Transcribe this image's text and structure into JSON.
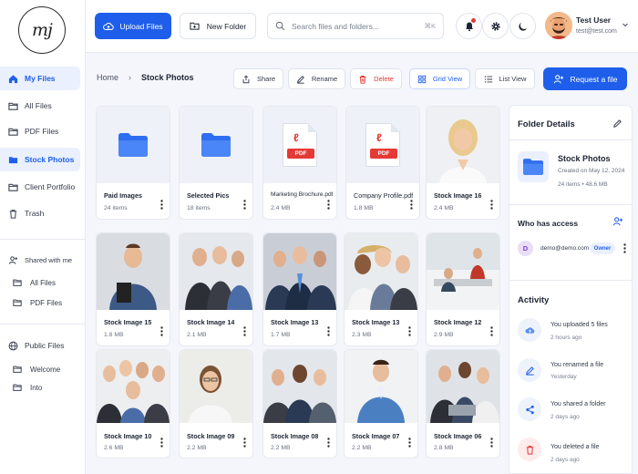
{
  "app": {
    "logo_text": "mj"
  },
  "sidebar": {
    "items": [
      {
        "label": "My Files"
      },
      {
        "label": "All Files"
      },
      {
        "label": "PDF Files"
      },
      {
        "label": "Stock Photos"
      },
      {
        "label": "Client Portfolio"
      },
      {
        "label": "Trash"
      }
    ],
    "shared": {
      "label": "Shared with me",
      "items": [
        "All Files",
        "PDF Files"
      ]
    },
    "public": {
      "label": "Public Files",
      "items": [
        "Welcome",
        "Into"
      ]
    }
  },
  "topbar": {
    "upload_label": "Upload Files",
    "new_folder_label": "New Folder",
    "search_placeholder": "Search files and folders...",
    "search_shortcut": "⌘K",
    "user": {
      "name": "Test User",
      "email": "test@test.com"
    }
  },
  "toolbar": {
    "breadcrumb": [
      "Home",
      "Stock Photos"
    ],
    "breadcrumb_sep": "›",
    "share": "Share",
    "rename": "Rename",
    "delete": "Delete",
    "grid_view": "Grid View",
    "list_view": "List View",
    "request": "Request a file"
  },
  "files": [
    {
      "name": "Paid Images",
      "meta": "24 items",
      "kind": "folder"
    },
    {
      "name": "Selected Pics",
      "meta": "18 items",
      "kind": "folder"
    },
    {
      "name": "Marketing Brochure.pdf",
      "meta": "2.4 MB",
      "kind": "pdf"
    },
    {
      "name": "Company Profile.pdf",
      "meta": "1.8 MB",
      "kind": "pdf"
    },
    {
      "name": "Stock Image 16",
      "meta": "2.4 MB",
      "kind": "photo"
    },
    {
      "name": "Stock Image 15",
      "meta": "1.8 MB",
      "kind": "photo"
    },
    {
      "name": "Stock Image 14",
      "meta": "2.1 MB",
      "kind": "photo"
    },
    {
      "name": "Stock Image 13",
      "meta": "1.7 MB",
      "kind": "photo"
    },
    {
      "name": "Stock Image 13",
      "meta": "2.3 MB",
      "kind": "photo"
    },
    {
      "name": "Stock Image 12",
      "meta": "2.9 MB",
      "kind": "photo"
    },
    {
      "name": "Stock Image 10",
      "meta": "2.6 MB",
      "kind": "photo"
    },
    {
      "name": "Stock Image 09",
      "meta": "2.2 MB",
      "kind": "photo"
    },
    {
      "name": "Stock Image 08",
      "meta": "2.2 MB",
      "kind": "photo"
    },
    {
      "name": "Stock Image 07",
      "meta": "2.2 MB",
      "kind": "photo"
    },
    {
      "name": "Stock Image 06",
      "meta": "2.8 MB",
      "kind": "photo"
    }
  ],
  "pdf_tag": "PDF",
  "details": {
    "title": "Folder Details",
    "folder_name": "Stock Photos",
    "created": "Created on May 12, 2024",
    "stats": "24 items  •  48.6 MB",
    "access_title": "Who has access",
    "access": {
      "initial": "D",
      "email": "demo@demo.com",
      "role": "Owner"
    },
    "activity_title": "Activity",
    "activity": [
      {
        "text": "You uploaded 5 files",
        "time": "2 hours ago",
        "icon": "upload-icon"
      },
      {
        "text": "You renamed a file",
        "time": "Yesterday",
        "icon": "pencil-icon"
      },
      {
        "text": "You shared a folder",
        "time": "2 days ago",
        "icon": "share-icon"
      },
      {
        "text": "You deleted a file",
        "time": "2 days ago",
        "icon": "trash-icon"
      }
    ]
  },
  "colors": {
    "accent": "#1f5eea",
    "danger": "#e53935",
    "folder": "#2f6df0"
  }
}
